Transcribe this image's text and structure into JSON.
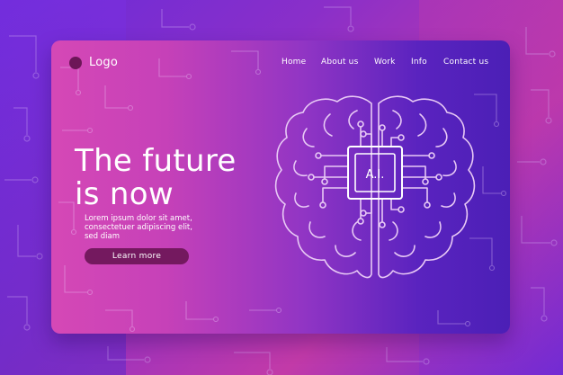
{
  "brand": {
    "logo_label": "Logo"
  },
  "nav": {
    "items": [
      "Home",
      "About us",
      "Work",
      "Info",
      "Contact us"
    ]
  },
  "hero": {
    "headline_lines": [
      "The future",
      "is now"
    ],
    "body_lines": [
      "Lorem ipsum dolor sit amet,",
      "consectetuer adipiscing elit,",
      "sed diam"
    ],
    "cta_label": "Learn more"
  },
  "illustration": {
    "chip_label": "A.I.",
    "icon": "brain-circuit-icon"
  },
  "colors": {
    "accent_dark": "#74195f",
    "card_left": "#d548b6",
    "card_right": "#4b1fb6",
    "line": "#e8c9f5"
  }
}
